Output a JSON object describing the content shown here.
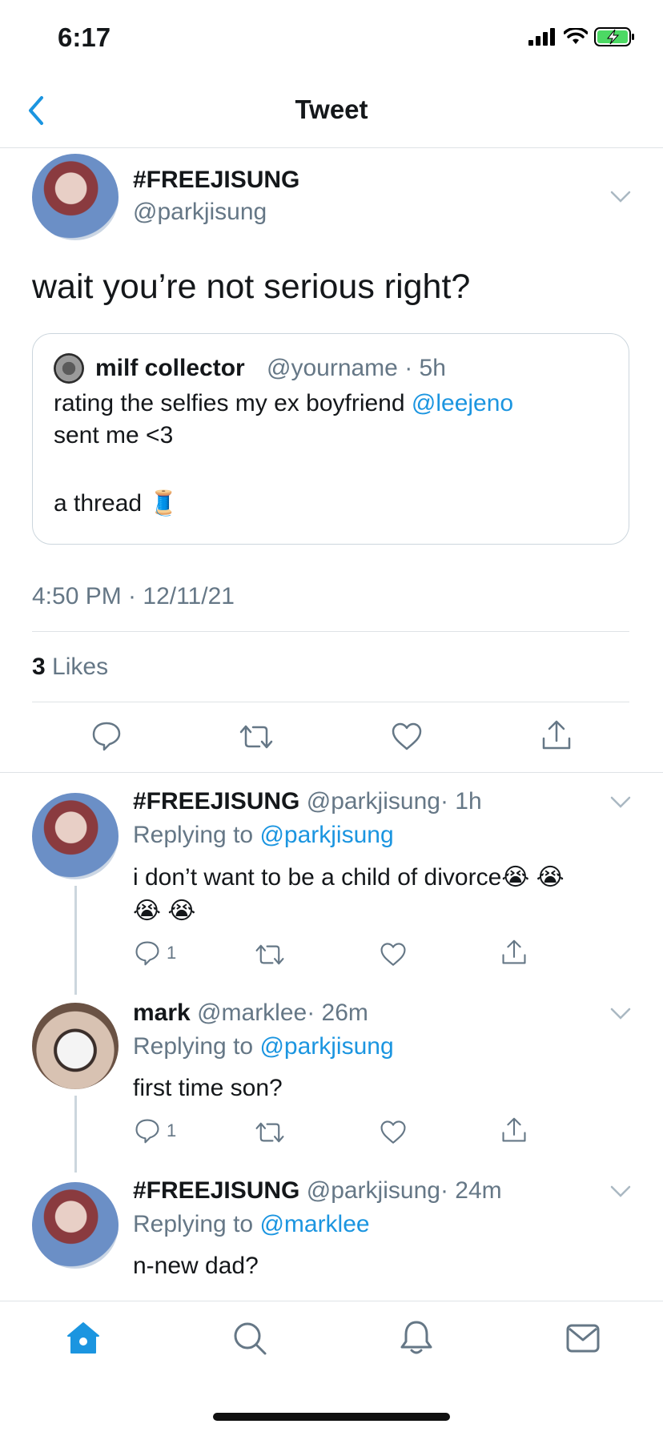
{
  "status_bar": {
    "time": "6:17"
  },
  "header": {
    "title": "Tweet",
    "back_icon": "chevron-left-icon"
  },
  "main_tweet": {
    "display_name": "#FREEJISUNG",
    "handle": "@parkjisung",
    "text": "wait you’re not serious right?",
    "quoted": {
      "display_name": "milf collector",
      "handle": "@yourname",
      "time": "· 5h",
      "text_before_mention": "rating the selfies my ex boyfriend",
      "mention": "@leejeno",
      "text_after_mention": "sent me <3",
      "text_line3": "a thread",
      "emoji": "🧵"
    },
    "timestamp": "4:50 PM · 12/11/21",
    "likes_count": "3",
    "likes_label": "Likes"
  },
  "replies": [
    {
      "display_name": "#FREEJISUNG",
      "handle": "@parkjisung",
      "time": "· 1h",
      "replying_to_label": "Replying to",
      "replying_to_handle": "@parkjisung",
      "text_line1": "i don’t want to be a child of divorce😭 😭",
      "text_line2": "😭 😭",
      "reply_count": "1"
    },
    {
      "display_name": "mark",
      "handle": "@marklee",
      "time": "· 26m",
      "replying_to_label": "Replying to",
      "replying_to_handle": "@parkjisung",
      "text_line1": "first time son?",
      "reply_count": "1"
    },
    {
      "display_name": "#FREEJISUNG",
      "handle": "@parkjisung",
      "time": "· 24m",
      "replying_to_label": "Replying to",
      "replying_to_handle": "@marklee",
      "text_line1": "n-new dad?"
    }
  ],
  "colors": {
    "accent": "#1b95e0",
    "text": "#14171a",
    "secondary": "#657786",
    "divider": "#dfe3e6"
  },
  "tab_bar": {
    "items": [
      "home-icon",
      "search-icon",
      "notifications-icon",
      "messages-icon"
    ]
  }
}
